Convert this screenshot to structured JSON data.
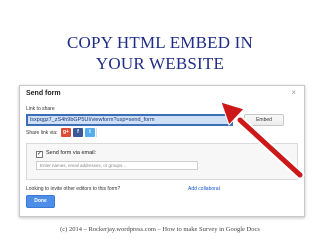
{
  "slide": {
    "title_line1": "COPY HTML EMBED IN",
    "title_line2": "YOUR  WEBSITE",
    "footer": "(c) 2014 – Rockerjay.wordpress.com – How to make Survey in Google Docs"
  },
  "dialog": {
    "title": "Send form",
    "close_glyph": "×",
    "link_label": "Link to share",
    "link_value": "lsxpqgz7_zS4h9bGP5UI/viewform?usp=send_form",
    "embed_label": "Embed",
    "share_label": "Share link via:",
    "share_icons": [
      {
        "name": "google-plus",
        "glyph": "g+",
        "color": "#dd4b39"
      },
      {
        "name": "facebook",
        "glyph": "f",
        "color": "#3b5998"
      },
      {
        "name": "twitter",
        "glyph": "t",
        "color": "#55acee"
      }
    ],
    "email": {
      "checkbox_glyph": "✓",
      "label": "Send form via email:",
      "placeholder": "Enter names, email addresses, or groups..."
    },
    "invite_label": "Looking to invite other editors to this form?",
    "collab_link": "Add collaborat",
    "done_label": "Done"
  },
  "colors": {
    "title": "#1f2d86",
    "arrow": "#cc1818",
    "done": "#4d8fe8",
    "link_highlight": "#cfe0f6"
  }
}
